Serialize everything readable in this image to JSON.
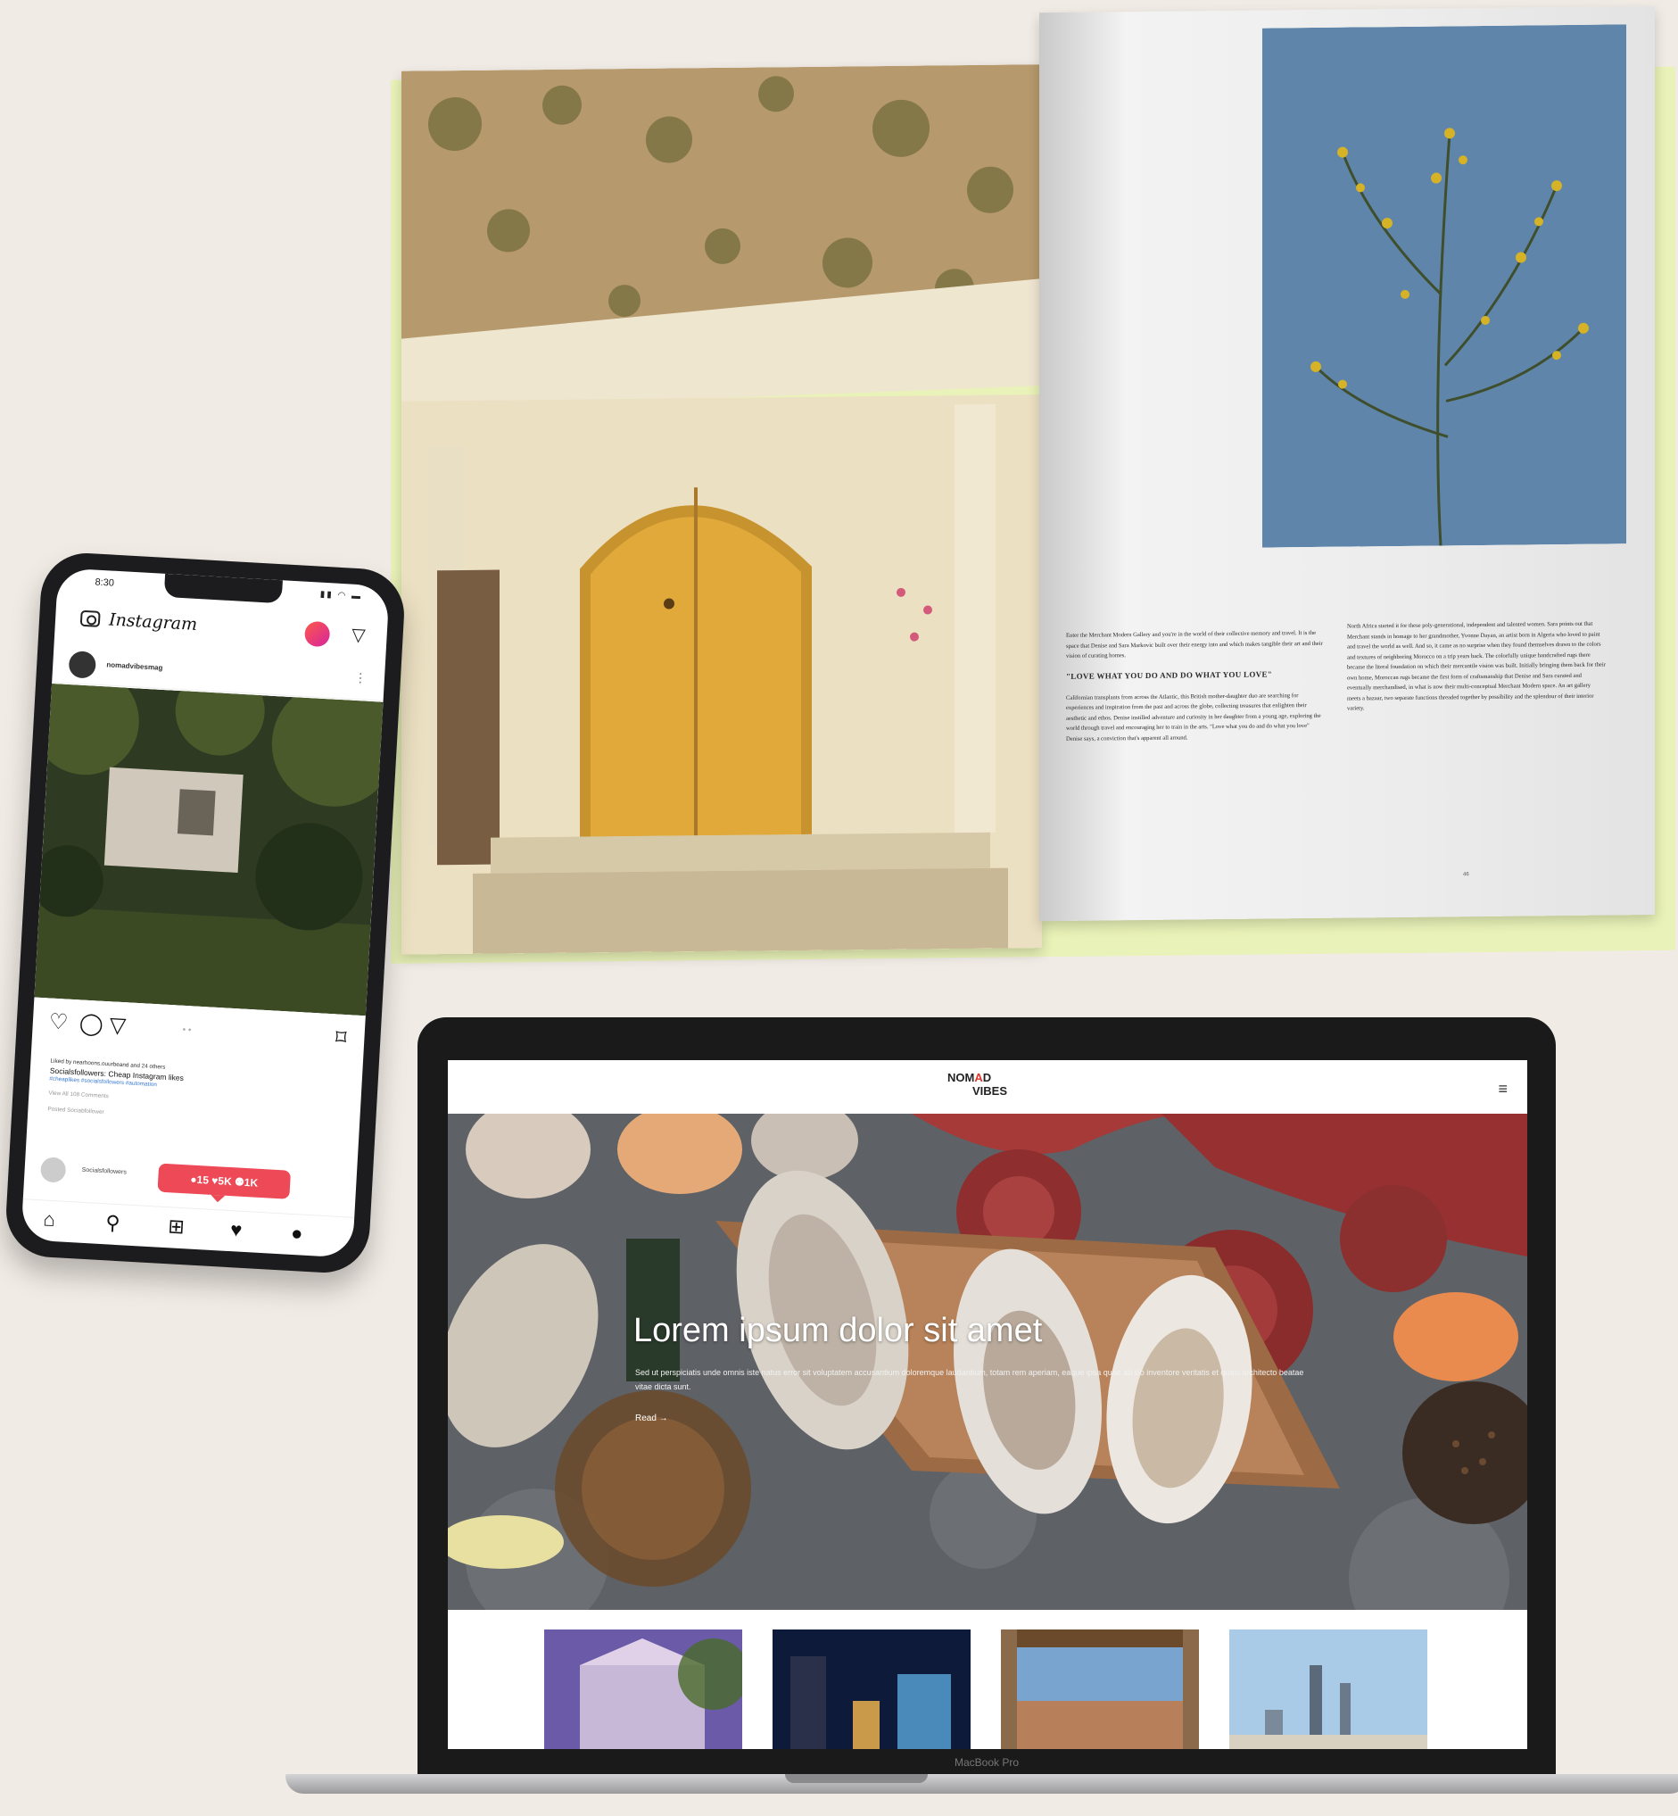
{
  "magazine": {
    "column1_intro": "Enter the Merchant Modern Gallery and you're in the world of their collective memory and travel. It is the space that Denise and Sara Markovic built over their energy into and which makes tangible their art and their vision of curating homes.",
    "pull_quote": "\"LOVE WHAT YOU DO AND DO WHAT YOU LOVE\"",
    "column1_body": "Californian transplants from across the Atlantic, this British mother-daughter duo are searching for experiences and inspiration from the past and across the globe, collecting treasures that enlighten their aesthetic and ethos. Denise instilled adventure and curiosity in her daughter from a young age, exploring the world through travel and encouraging her to train in the arts. \"Love what you do and do what you love\" Denise says, a conviction that's apparent all around.",
    "column2_body": "North Africa started it for these poly-generational, independent and talented women. Sara points out that Merchant stands in homage to her grandmother, Yvonne Dayan, an artist born in Algeria who loved to paint and travel the world as well. And so, it came as no surprise when they found themselves drawn to the colors and textures of neighboring Morocco on a trip years back. The colorfully unique handcrafted rugs there became the literal foundation on which their mercantile vision was built. Initially bringing them back for their own home, Moroccan rugs became the first form of craftsmanship that Denise and Sara curated and eventually merchandised, in what is now their multi-conceptual Merchant Modern space. An art gallery meets a bazaar, two separate functions threaded together by possibility and the splendour of their interior variety.",
    "page_number": "46"
  },
  "phone": {
    "status_time": "8:30",
    "status_icons": "▮▮ ◠ ▬",
    "app_name": "Instagram",
    "post_username": "nomadvibesmag",
    "post_more": "⋮",
    "likes_line": "Liked by nearhoons.ouurbeand and 24 others",
    "caption_big": "Socialsfollowers: Cheap Instagram likes",
    "caption_tags": "#cheaplikes #socialsfollowers #automation",
    "view_comments": "View All 108 Comments",
    "time_line": "Posted  Sociabfollower",
    "comment_user": "Socialsfollowers",
    "notification": "●15  ♥5K  ⚉1K",
    "page_dots": "• •"
  },
  "laptop": {
    "brand_line1_a": "NOM",
    "brand_line1_accent": "A",
    "brand_line1_b": "D",
    "brand_line2": "VIBES",
    "hero_title": "Lorem ipsum dolor sit amet",
    "hero_text": "Sed ut perspiciatis unde omnis iste natus error sit voluptatem accusantium doloremque laudantium, totam rem aperiam, eaque ipsa quae ab illo inventore veritatis et quasi architecto beatae vitae dicta sunt.",
    "hero_link": "Read  →",
    "device_label": "MacBook Pro"
  },
  "icons": {
    "menu": "≡",
    "send": "▽",
    "heart": "♡",
    "comment": "◯",
    "share": "▽",
    "bookmark": "⌑",
    "home": "⌂",
    "search": "⚲",
    "add": "⊞",
    "activity": "♥",
    "profile": "●"
  }
}
